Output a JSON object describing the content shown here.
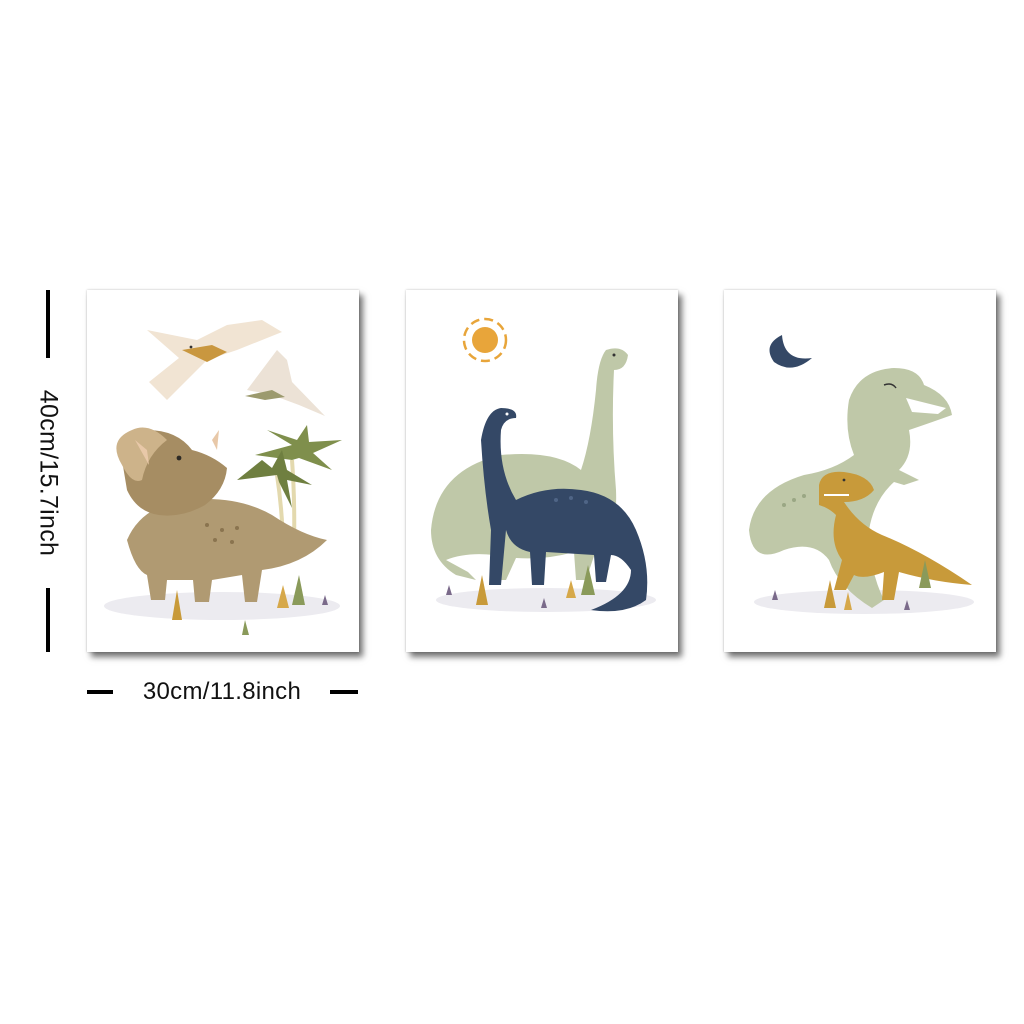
{
  "dimensions": {
    "height_label": "40cm/15.7inch",
    "width_label": "30cm/11.8inch"
  },
  "prints": [
    {
      "subject": "triceratops-with-pterodactyls-and-palm-trees"
    },
    {
      "subject": "two-long-neck-dinosaurs-with-sun"
    },
    {
      "subject": "t-rex-pair-with-crescent-moon"
    }
  ],
  "colors": {
    "tan": "#b09a72",
    "sage": "#bfc8a8",
    "navy": "#344866",
    "mustard": "#c89a3a",
    "sun": "#e8a53a",
    "palm": "#7f8f4c"
  }
}
